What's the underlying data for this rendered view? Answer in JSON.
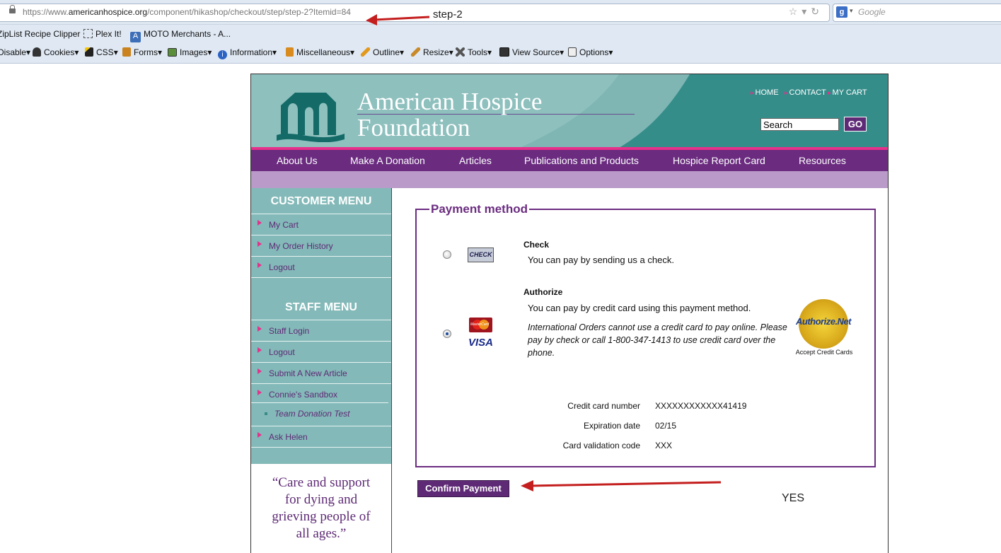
{
  "browser": {
    "url_prefix": "https://www.",
    "url_domain": "americanhospice.org",
    "url_path": "/component/hikashop/checkout/step/step-2?Itemid=84",
    "search_engine_letter": "g",
    "search_placeholder": "Google"
  },
  "bookmarks": [
    "ZipList Recipe Clipper",
    "Plex It!",
    "MOTO Merchants - A..."
  ],
  "devbar": [
    "Disable",
    "Cookies",
    "CSS",
    "Forms",
    "Images",
    "Information",
    "Miscellaneous",
    "Outline",
    "Resize",
    "Tools",
    "View Source",
    "Options"
  ],
  "annotations": {
    "step_label": "step-2",
    "yes_label": "YES",
    "arrow_color": "#c41e1e"
  },
  "site": {
    "title_line1": "American Hospice",
    "title_line2": "Foundation",
    "toplinks": [
      "HOME",
      "CONTACT",
      "MY CART"
    ],
    "search_value": "Search",
    "go_label": "GO",
    "nav": [
      "About Us",
      "Make A Donation",
      "Articles",
      "Publications and Products",
      "Hospice Report Card",
      "Resources"
    ],
    "colors": {
      "teal": "#358d8a",
      "purple": "#6b2c80",
      "pink": "#e7308a",
      "lilac": "#b99ac8",
      "sidebar": "#83b9b8"
    }
  },
  "sidebar": {
    "customer_heading": "CUSTOMER MENU",
    "customer_items": [
      "My Cart",
      "My Order History",
      "Logout"
    ],
    "staff_heading": "STAFF MENU",
    "staff_items": [
      "Staff Login",
      "Logout",
      "Submit A New Article",
      "Connie's Sandbox"
    ],
    "staff_subitem": "Team Donation Test",
    "staff_last_item": "Ask Helen",
    "quote_lines": [
      "“Care and support",
      "for dying and",
      "grieving people of",
      "all ages.”"
    ]
  },
  "payment": {
    "legend": "Payment method",
    "check_title": "Check",
    "check_logo": "CHECK",
    "check_desc": "You can pay by sending us a check.",
    "authorize_title": "Authorize",
    "authorize_desc": "You can pay by credit card using this payment method.",
    "authorize_note": "International Orders cannot use a credit card to pay online. Please pay by check or call 1-800-347-1413 to use credit card over the phone.",
    "visa_logo": "VISA",
    "mastercard_logo": "MasterCard",
    "seal_text": "Authorize.Net",
    "seal_caption": "Accept Credit Cards",
    "selected_method": "Authorize",
    "cc_number_label": "Credit card number",
    "cc_number_value": "XXXXXXXXXXXX41419",
    "expiration_label": "Expiration date",
    "expiration_value": "02/15",
    "cvv_label": "Card validation code",
    "cvv_value": "XXX",
    "confirm_label": "Confirm Payment"
  }
}
